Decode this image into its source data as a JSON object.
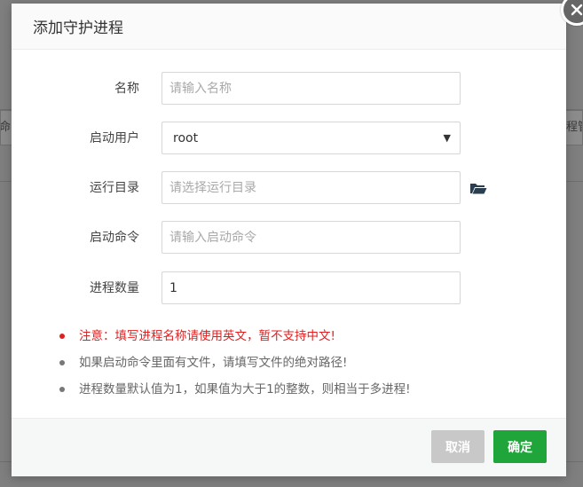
{
  "background": {
    "left_cell_text": "命",
    "right_cell_text": "程管"
  },
  "modal": {
    "title": "添加守护进程",
    "fields": {
      "name": {
        "label": "名称",
        "placeholder": "请输入名称",
        "value": ""
      },
      "user": {
        "label": "启动用户",
        "selected": "root"
      },
      "run_dir": {
        "label": "运行目录",
        "placeholder": "请选择运行目录",
        "value": ""
      },
      "command": {
        "label": "启动命令",
        "placeholder": "请输入启动命令",
        "value": ""
      },
      "process_count": {
        "label": "进程数量",
        "value": "1"
      }
    },
    "notes": [
      {
        "text": "注意：填写进程名称请使用英文，暂不支持中文!",
        "type": "warning"
      },
      {
        "text": "如果启动命令里面有文件，请填写文件的绝对路径!",
        "type": "info"
      },
      {
        "text": "进程数量默认值为1，如果值为大于1的整数，则相当于多进程!",
        "type": "info"
      }
    ],
    "buttons": {
      "cancel": "取消",
      "confirm": "确定"
    }
  },
  "colors": {
    "primary": "#20a53a",
    "warning": "#e02020",
    "cancel": "#c8c8c8"
  },
  "icons": {
    "close": "close-icon",
    "folder": "folder-open-icon",
    "caret": "caret-down-icon"
  }
}
